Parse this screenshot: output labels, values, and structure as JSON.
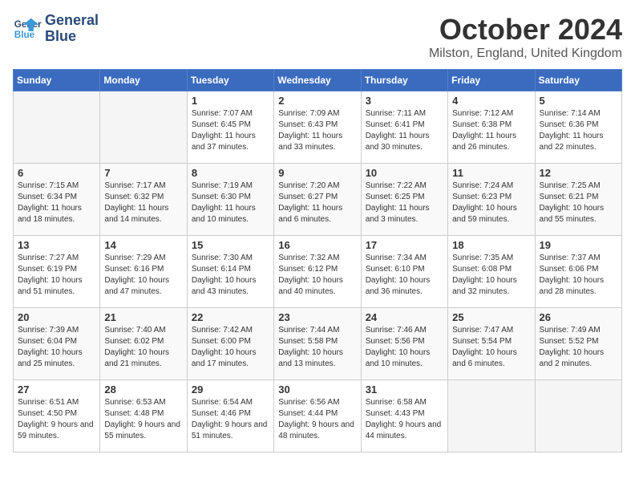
{
  "header": {
    "logo_line1": "General",
    "logo_line2": "Blue",
    "month": "October 2024",
    "location": "Milston, England, United Kingdom"
  },
  "days_of_week": [
    "Sunday",
    "Monday",
    "Tuesday",
    "Wednesday",
    "Thursday",
    "Friday",
    "Saturday"
  ],
  "weeks": [
    [
      {
        "day": "",
        "info": ""
      },
      {
        "day": "",
        "info": ""
      },
      {
        "day": "1",
        "info": "Sunrise: 7:07 AM\nSunset: 6:45 PM\nDaylight: 11 hours and 37 minutes."
      },
      {
        "day": "2",
        "info": "Sunrise: 7:09 AM\nSunset: 6:43 PM\nDaylight: 11 hours and 33 minutes."
      },
      {
        "day": "3",
        "info": "Sunrise: 7:11 AM\nSunset: 6:41 PM\nDaylight: 11 hours and 30 minutes."
      },
      {
        "day": "4",
        "info": "Sunrise: 7:12 AM\nSunset: 6:38 PM\nDaylight: 11 hours and 26 minutes."
      },
      {
        "day": "5",
        "info": "Sunrise: 7:14 AM\nSunset: 6:36 PM\nDaylight: 11 hours and 22 minutes."
      }
    ],
    [
      {
        "day": "6",
        "info": "Sunrise: 7:15 AM\nSunset: 6:34 PM\nDaylight: 11 hours and 18 minutes."
      },
      {
        "day": "7",
        "info": "Sunrise: 7:17 AM\nSunset: 6:32 PM\nDaylight: 11 hours and 14 minutes."
      },
      {
        "day": "8",
        "info": "Sunrise: 7:19 AM\nSunset: 6:30 PM\nDaylight: 11 hours and 10 minutes."
      },
      {
        "day": "9",
        "info": "Sunrise: 7:20 AM\nSunset: 6:27 PM\nDaylight: 11 hours and 6 minutes."
      },
      {
        "day": "10",
        "info": "Sunrise: 7:22 AM\nSunset: 6:25 PM\nDaylight: 11 hours and 3 minutes."
      },
      {
        "day": "11",
        "info": "Sunrise: 7:24 AM\nSunset: 6:23 PM\nDaylight: 10 hours and 59 minutes."
      },
      {
        "day": "12",
        "info": "Sunrise: 7:25 AM\nSunset: 6:21 PM\nDaylight: 10 hours and 55 minutes."
      }
    ],
    [
      {
        "day": "13",
        "info": "Sunrise: 7:27 AM\nSunset: 6:19 PM\nDaylight: 10 hours and 51 minutes."
      },
      {
        "day": "14",
        "info": "Sunrise: 7:29 AM\nSunset: 6:16 PM\nDaylight: 10 hours and 47 minutes."
      },
      {
        "day": "15",
        "info": "Sunrise: 7:30 AM\nSunset: 6:14 PM\nDaylight: 10 hours and 43 minutes."
      },
      {
        "day": "16",
        "info": "Sunrise: 7:32 AM\nSunset: 6:12 PM\nDaylight: 10 hours and 40 minutes."
      },
      {
        "day": "17",
        "info": "Sunrise: 7:34 AM\nSunset: 6:10 PM\nDaylight: 10 hours and 36 minutes."
      },
      {
        "day": "18",
        "info": "Sunrise: 7:35 AM\nSunset: 6:08 PM\nDaylight: 10 hours and 32 minutes."
      },
      {
        "day": "19",
        "info": "Sunrise: 7:37 AM\nSunset: 6:06 PM\nDaylight: 10 hours and 28 minutes."
      }
    ],
    [
      {
        "day": "20",
        "info": "Sunrise: 7:39 AM\nSunset: 6:04 PM\nDaylight: 10 hours and 25 minutes."
      },
      {
        "day": "21",
        "info": "Sunrise: 7:40 AM\nSunset: 6:02 PM\nDaylight: 10 hours and 21 minutes."
      },
      {
        "day": "22",
        "info": "Sunrise: 7:42 AM\nSunset: 6:00 PM\nDaylight: 10 hours and 17 minutes."
      },
      {
        "day": "23",
        "info": "Sunrise: 7:44 AM\nSunset: 5:58 PM\nDaylight: 10 hours and 13 minutes."
      },
      {
        "day": "24",
        "info": "Sunrise: 7:46 AM\nSunset: 5:56 PM\nDaylight: 10 hours and 10 minutes."
      },
      {
        "day": "25",
        "info": "Sunrise: 7:47 AM\nSunset: 5:54 PM\nDaylight: 10 hours and 6 minutes."
      },
      {
        "day": "26",
        "info": "Sunrise: 7:49 AM\nSunset: 5:52 PM\nDaylight: 10 hours and 2 minutes."
      }
    ],
    [
      {
        "day": "27",
        "info": "Sunrise: 6:51 AM\nSunset: 4:50 PM\nDaylight: 9 hours and 59 minutes."
      },
      {
        "day": "28",
        "info": "Sunrise: 6:53 AM\nSunset: 4:48 PM\nDaylight: 9 hours and 55 minutes."
      },
      {
        "day": "29",
        "info": "Sunrise: 6:54 AM\nSunset: 4:46 PM\nDaylight: 9 hours and 51 minutes."
      },
      {
        "day": "30",
        "info": "Sunrise: 6:56 AM\nSunset: 4:44 PM\nDaylight: 9 hours and 48 minutes."
      },
      {
        "day": "31",
        "info": "Sunrise: 6:58 AM\nSunset: 4:43 PM\nDaylight: 9 hours and 44 minutes."
      },
      {
        "day": "",
        "info": ""
      },
      {
        "day": "",
        "info": ""
      }
    ]
  ]
}
